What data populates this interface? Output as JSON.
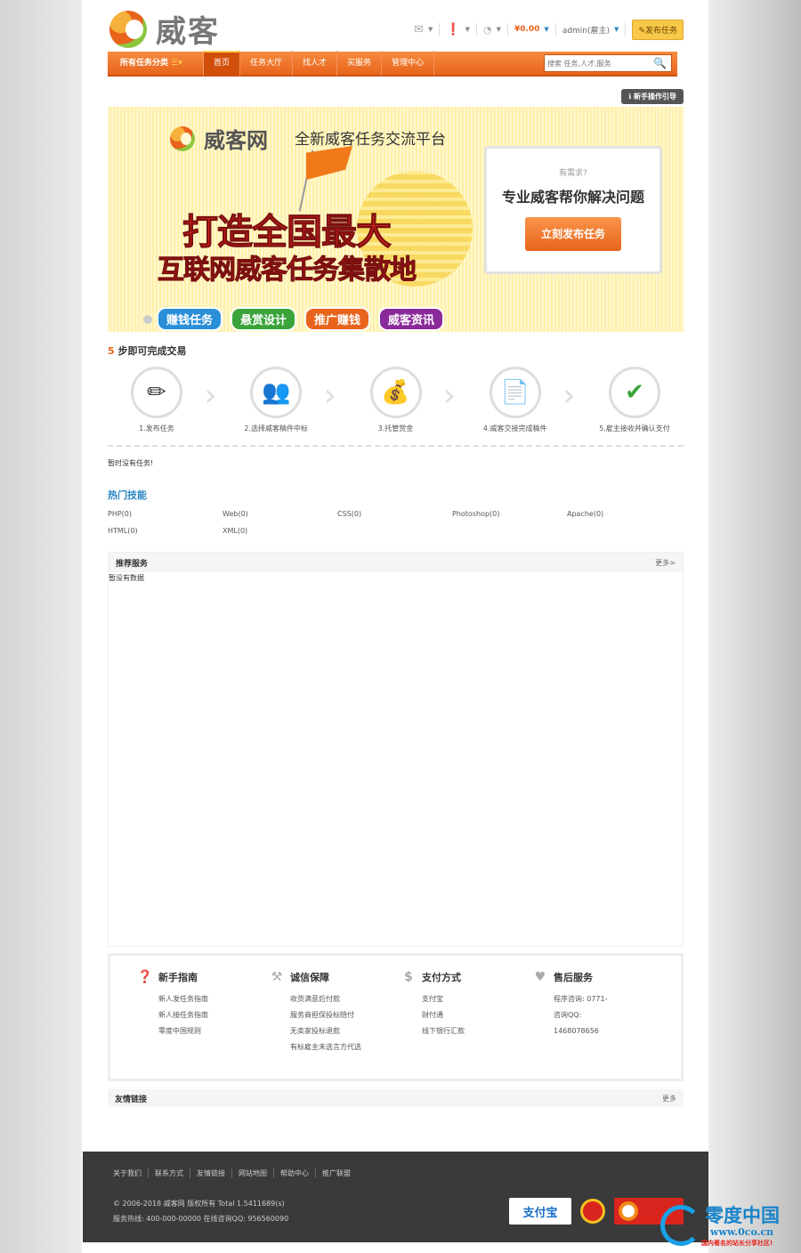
{
  "header": {
    "logo_text": "威客",
    "balance": "¥0.00",
    "user": "admin(雇主)",
    "post_task": "发布任务"
  },
  "nav": {
    "category": "所有任务分类",
    "items": [
      "首页",
      "任务大厅",
      "找人才",
      "买服务",
      "管理中心"
    ],
    "search_placeholder": "搜索 任务,人才,服务"
  },
  "guide_button": "新手操作引导",
  "banner": {
    "brand": "威客网",
    "slogan": "全新威客任务交流平台",
    "headline1": "打造全国最大",
    "headline2": "互联网威客任务集散地",
    "need_question": "有需求?",
    "need_title": "专业威客帮你解决问题",
    "need_button": "立刻发布任务",
    "tabs": [
      "赚钱任务",
      "悬赏设计",
      "推广赚钱",
      "威客资讯"
    ],
    "tab_colors": [
      "#2a8fd8",
      "#3aa43a",
      "#e8641c",
      "#8a2a9a"
    ]
  },
  "steps": {
    "title_num": "5",
    "title": "步即可完成交易",
    "items": [
      "1.发布任务",
      "2.选择威客稿件中标",
      "3.托管赏金",
      "4.威客交接完成稿件",
      "5.雇主接收并确认支付"
    ]
  },
  "no_task": "暂时没有任务!",
  "hot_skills": {
    "title": "热门技能",
    "items": [
      "PHP(0)",
      "Web(0)",
      "CSS(0)",
      "Photoshop(0)",
      "Apache(0)",
      "HTML(0)",
      "XML(0)"
    ]
  },
  "recommended": {
    "title": "推荐服务",
    "more": "更多>",
    "empty": "暂没有数据"
  },
  "services": [
    {
      "title": "新手指南",
      "icon": "question-icon",
      "items": [
        "新人发任务指南",
        "新人接任务指南",
        "零度中国规则"
      ]
    },
    {
      "title": "诚信保障",
      "icon": "gavel-icon",
      "items": [
        "收货满意后付款",
        "服务商担保投标赔付",
        "无卖家投标退款",
        "有标雇主未选言方代选"
      ]
    },
    {
      "title": "支付方式",
      "icon": "dollar-icon",
      "items": [
        "支付宝",
        "财付通",
        "线下银行汇款"
      ]
    },
    {
      "title": "售后服务",
      "icon": "heart-icon",
      "items": [
        "程序咨询: 0771-",
        "咨询QQ:",
        "1468078656"
      ]
    }
  ],
  "friend_links": {
    "title": "友情链接",
    "more": "更多"
  },
  "footer": {
    "links": [
      "关于我们",
      "联系方式",
      "友情链接",
      "网站地图",
      "帮助中心",
      "推广联盟"
    ],
    "copyright": "© 2006-2018 威客网 版权所有 Total 1.5411689(s)",
    "hotline": "服务热线: 400-000-00000 在线咨询QQ: 956560090",
    "alipay": "支付宝"
  },
  "watermark": {
    "t1": "零度中国",
    "t2": "www.0co.cn",
    "t3": "国内著名的站长分享社区!"
  }
}
